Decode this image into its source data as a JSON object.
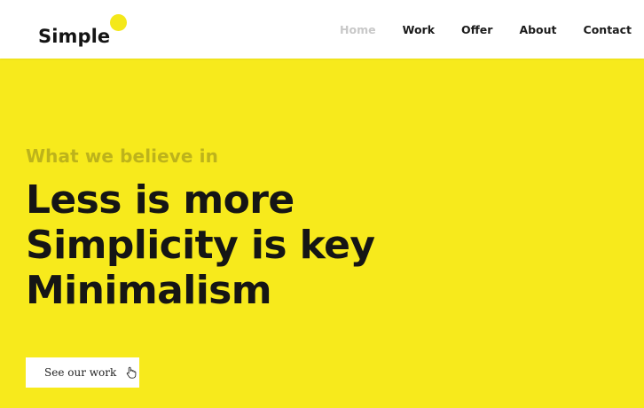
{
  "header": {
    "logo_text": "Simple",
    "logo_badge": "",
    "nav": [
      {
        "label": "Home",
        "active": true
      },
      {
        "label": "Work",
        "active": false
      },
      {
        "label": "Offer",
        "active": false
      },
      {
        "label": "About",
        "active": false
      },
      {
        "label": "Contact",
        "active": false
      }
    ]
  },
  "hero": {
    "kicker": "What we believe in",
    "headline_lines": [
      "Less is more",
      "Simplicity is key",
      "Minimalism"
    ],
    "cta_label": "See our work",
    "cta_icon": "hand-pointer-icon"
  },
  "colors": {
    "background": "#f7ea1c",
    "accent_kicker": "#bdb31b",
    "text": "#151515",
    "nav_active": "#c8c8c8"
  }
}
